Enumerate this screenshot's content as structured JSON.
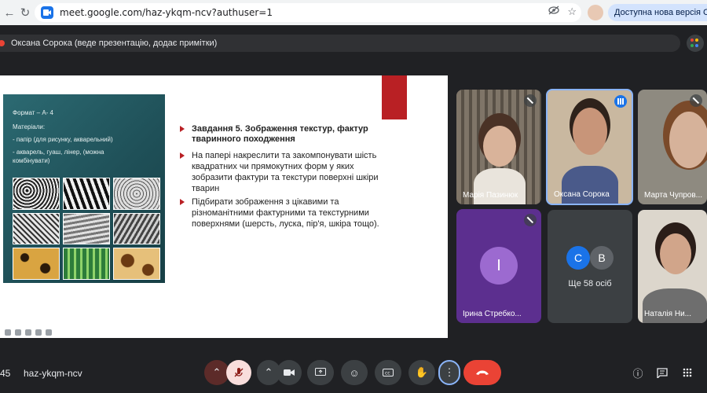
{
  "browser": {
    "url": "meet.google.com/haz-ykqm-ncv?authuser=1",
    "update_label": "Доступна нова версія Chrom"
  },
  "presenter": {
    "text": "Оксана Сорока (веде презентацію, додає примітки)"
  },
  "slide": {
    "left_panel": {
      "format": "Формат – А- 4",
      "materials_title": "Матеріали:",
      "material_1": "- папір (для рисунку, акварельний)",
      "material_2a": "- акварель, гуаш, лінер, (можна",
      "material_2b": "комбінувати)"
    },
    "task_title_line1": "Завдання 5. Зображення текстур, фактур",
    "task_title_line2": "тваринного походження",
    "item1_line1": "На папері накреслити та закомпонувати шість",
    "item1_line2": "квадратних чи прямокутних форм у яких",
    "item1_line3": "зобразити фактури та текстури поверхні шкіри",
    "item1_line4": "тварин",
    "item2_line1": "Підбирати зображення з цікавими та",
    "item2_line2": "різноманітними фактурними та текстурними",
    "item2_line3": "поверхнями (шерсть, луска, пір'я, шкіра тощо)."
  },
  "participants": {
    "p1": "Марія Пазинюк",
    "p2": "Оксана Сорока",
    "p3": "Марта Чупров...",
    "p4": "Ірина Стребко...",
    "p4_initial": "I",
    "more_label": "Ще 58 осіб",
    "more_avatar_1": "С",
    "more_avatar_2": "В",
    "p5": "Наталія Ни..."
  },
  "bottom": {
    "time": "45",
    "meeting_code": "haz-ykqm-ncv"
  },
  "colors": {
    "accent": "#1a73e8",
    "end_call": "#ea4335",
    "slide_red": "#b92024"
  }
}
